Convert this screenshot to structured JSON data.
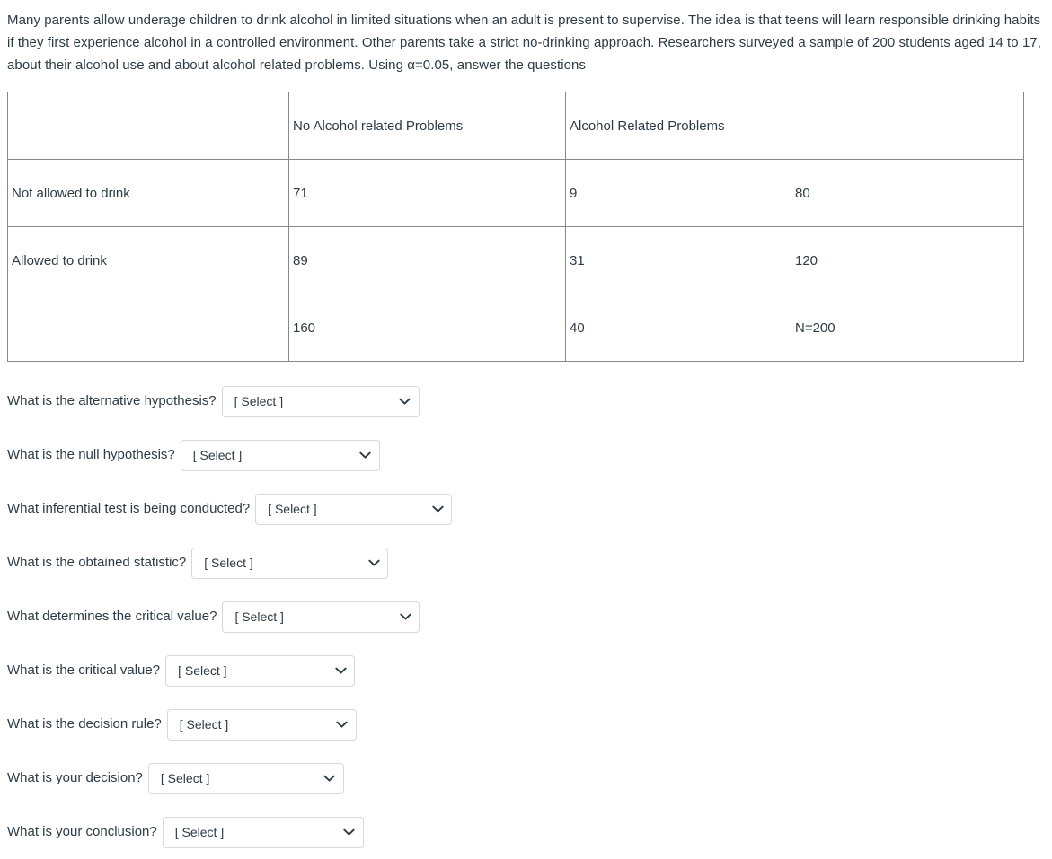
{
  "prompt": {
    "text": "Many parents allow underage children to drink alcohol in limited situations when an adult is present to supervise. The idea is that teens will learn responsible drinking habits if they first experience alcohol in a controlled environment. Other parents take a strict no-drinking approach. Researchers surveyed a sample of 200 students aged 14 to 17, about their alcohol use and about alcohol related problems. Using α=0.05, answer the questions"
  },
  "table": {
    "headers": [
      "",
      "No Alcohol related Problems",
      "Alcohol Related Problems",
      ""
    ],
    "rows": [
      {
        "cells": [
          "Not allowed to drink",
          "71",
          "9",
          "80"
        ]
      },
      {
        "cells": [
          "Allowed to drink",
          "89",
          "31",
          "120"
        ]
      },
      {
        "cells": [
          "",
          "160",
          "40",
          "N=200"
        ]
      }
    ]
  },
  "questions": [
    {
      "label": "What is the alternative hypothesis?",
      "value": "[ Select ]",
      "width_class": "w220"
    },
    {
      "label": "What is the null hypothesis?",
      "value": "[ Select ]",
      "width_class": "w222"
    },
    {
      "label": "What inferential test is being conducted?",
      "value": "[ Select ]",
      "width_class": "w219"
    },
    {
      "label": "What is the obtained statistic?",
      "value": "[ Select ]",
      "width_class": "w219"
    },
    {
      "label": "What determines the critical value?",
      "value": "[ Select ]",
      "width_class": "w220"
    },
    {
      "label": "What is the critical value?",
      "value": "[ Select ]",
      "width_class": "w211"
    },
    {
      "label": "What is the decision rule?",
      "value": "[ Select ]",
      "width_class": "w211"
    },
    {
      "label": "What is your decision?",
      "value": "[ Select ]",
      "width_class": "w218"
    },
    {
      "label": "What is your conclusion?",
      "value": "[ Select ]",
      "width_class": "w224"
    }
  ],
  "colors": {
    "text": "#2d3b45",
    "table_border": "#888888",
    "select_border": "#d8d8d8",
    "background": "#ffffff"
  },
  "icons": {
    "dropdown": "chevron-down-icon"
  }
}
